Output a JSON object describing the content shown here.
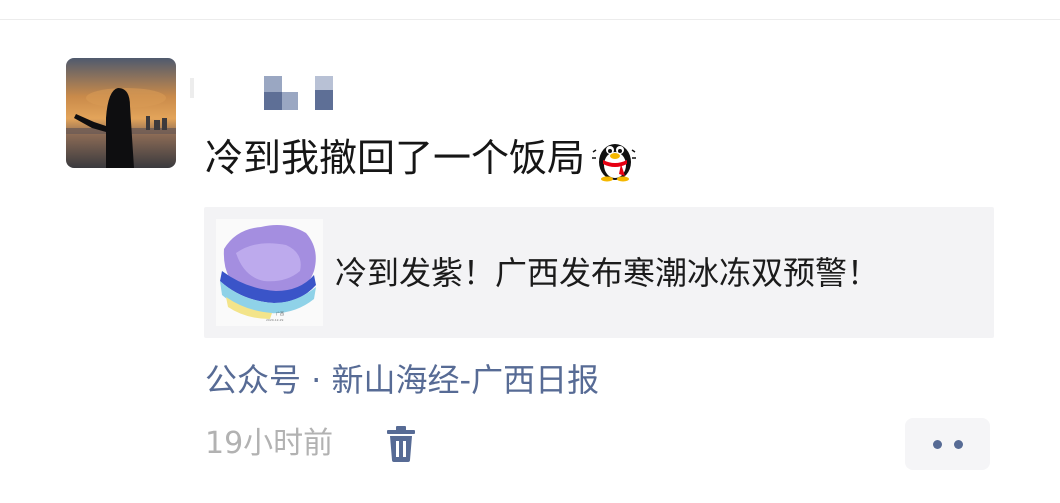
{
  "post": {
    "author": {
      "avatar_icon": "profile-photo-silhouette-sunset",
      "name_icon": "pixelated-name"
    },
    "text": "冷到我撤回了一个饭局",
    "emoji_icon": "qq-penguin-shivering-icon",
    "link_card": {
      "title": "冷到发紫！广西发布寒潮冰冻双预警！",
      "thumbnail_icon": "guangxi-temperature-map"
    },
    "source": "公众号 · 新山海经-广西日报",
    "time": "19小时前",
    "delete_icon": "trash-icon",
    "more_icon": "more-dots-icon"
  },
  "colors": {
    "link": "#576b95",
    "meta": "#b2b2b2",
    "card_bg": "#f3f3f5",
    "text": "#161616"
  }
}
